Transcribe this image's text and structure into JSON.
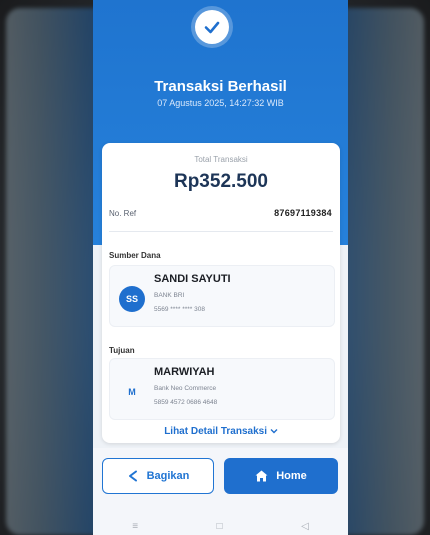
{
  "header": {
    "title": "Transaksi Berhasil",
    "datetime": "07 Agustus 2025, 14:27:32 WIB"
  },
  "receipt": {
    "total_label": "Total Transaksi",
    "total_amount": "Rp352.500",
    "ref_label": "No. Ref",
    "ref_value": "87697119384"
  },
  "source": {
    "section_label": "Sumber Dana",
    "initials": "SS",
    "name": "SANDI SAYUTI",
    "bank": "BANK BRI",
    "account": "5569 **** **** 308"
  },
  "destination": {
    "section_label": "Tujuan",
    "initials": "M",
    "name": "MARWIYAH",
    "bank": "Bank Neo Commerce",
    "account": "5859 4572 0686 4648"
  },
  "detail_link": "Lihat Detail Transaksi",
  "actions": {
    "share_label": "Bagikan",
    "home_label": "Home"
  },
  "navbar": {
    "recent": "≡",
    "home": "□",
    "back": "◁"
  },
  "colors": {
    "primary": "#1f6fce",
    "hero": "#2681db"
  }
}
